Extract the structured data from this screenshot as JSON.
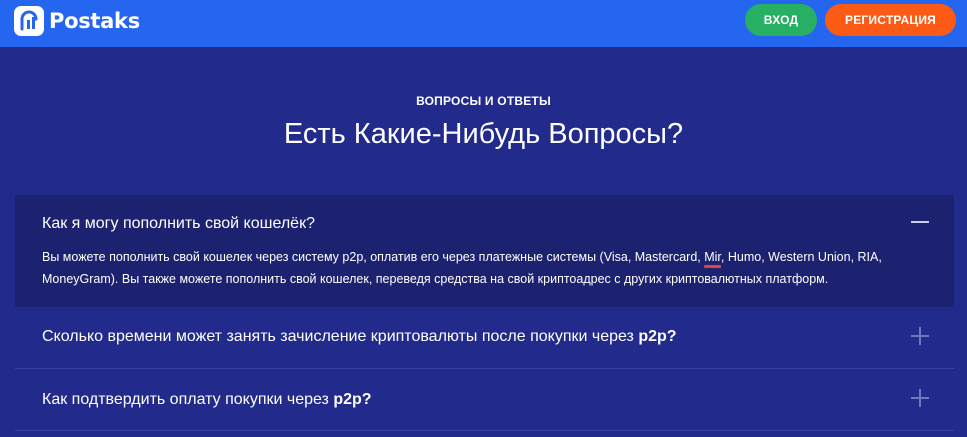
{
  "header": {
    "brand": "Postaks",
    "login_label": "ВХОД",
    "register_label": "РЕГИСТРАЦИЯ",
    "colors": {
      "bar": "#2566f0",
      "login": "#27b063",
      "register": "#fd5a16"
    }
  },
  "section": {
    "eyebrow": "ВОПРОСЫ И ОТВЕТЫ",
    "title": "Есть Какие-Нибудь Вопросы?"
  },
  "faq": [
    {
      "question": "Как я могу пополнить свой кошелёк?",
      "expanded": true,
      "answer_prefix": "Вы можете пополнить свой кошелек через систему p2p, оплатив его через платежные системы (Visa, Mastercard, ",
      "answer_highlight": "Mir",
      "answer_suffix": ", Humo, Western Union, RIA, MoneyGram). Вы также можете пополнить свой кошелек, переведя средства на свой криптоадрес с других криптовалютных платформ.",
      "toggle_icon": "minus-icon"
    },
    {
      "question": "Сколько времени может занять зачисление криптовалюты после покупки через",
      "question_bold": "p2p?",
      "expanded": false,
      "toggle_icon": "plus-icon"
    },
    {
      "question": "Как подтвердить оплату покупки через",
      "question_bold": "p2p?",
      "expanded": false,
      "toggle_icon": "plus-icon"
    }
  ]
}
